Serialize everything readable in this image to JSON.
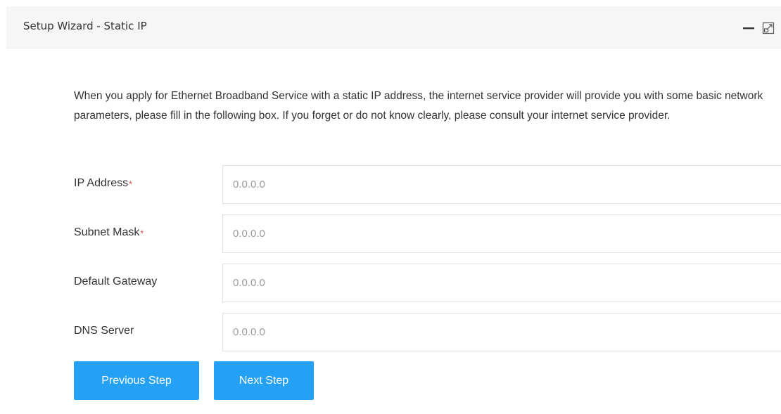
{
  "panel": {
    "title": "Setup Wizard - Static IP",
    "tools": {
      "minimize_icon": "minimize-icon",
      "maximize_icon": "maximize-icon"
    }
  },
  "description": "When you apply for Ethernet Broadband Service with a static IP address, the internet service provider will provide you with some basic network parameters, please fill in the following box. If you forget or do not know clearly, please consult your internet service provider.",
  "form": {
    "required_mark": "*",
    "ip_address": {
      "label": "IP Address",
      "required": true,
      "value": "",
      "placeholder": "0.0.0.0"
    },
    "subnet_mask": {
      "label": "Subnet Mask",
      "required": true,
      "value": "",
      "placeholder": "0.0.0.0"
    },
    "default_gateway": {
      "label": "Default Gateway",
      "required": false,
      "value": "",
      "placeholder": "0.0.0.0"
    },
    "dns_server": {
      "label": "DNS Server",
      "required": false,
      "value": "",
      "placeholder": "0.0.0.0"
    }
  },
  "buttons": {
    "previous_label": "Previous Step",
    "next_label": "Next Step"
  },
  "colors": {
    "accent": "#24a0f5",
    "required": "#e63c3c",
    "header_bg": "#f6f6f6"
  }
}
